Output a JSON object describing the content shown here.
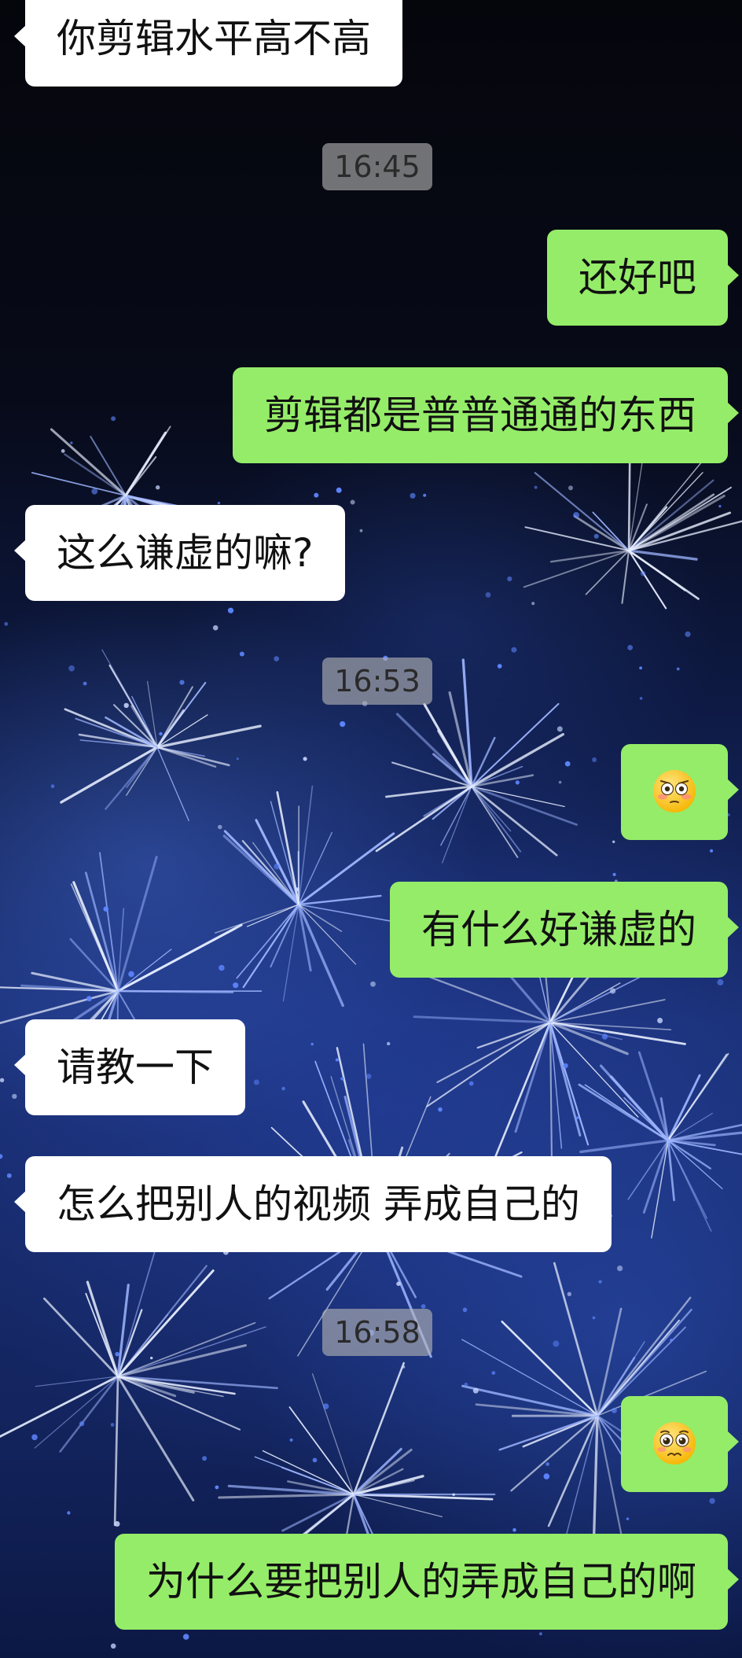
{
  "messages": [
    {
      "side": "incoming",
      "text": "你剪辑水平高不高"
    },
    {
      "time": "16:45"
    },
    {
      "side": "outgoing",
      "text": "还好吧"
    },
    {
      "side": "outgoing",
      "text": "剪辑都是普普通通的东西"
    },
    {
      "side": "incoming",
      "text": "这么谦虚的嘛?"
    },
    {
      "time": "16:53"
    },
    {
      "side": "outgoing",
      "emoji": "flushed-face-icon"
    },
    {
      "side": "outgoing",
      "text": "有什么好谦虚的"
    },
    {
      "side": "incoming",
      "text": "请教一下"
    },
    {
      "side": "incoming",
      "text": "怎么把别人的视频 弄成自己的"
    },
    {
      "time": "16:58"
    },
    {
      "side": "outgoing",
      "emoji": "pleading-face-icon"
    },
    {
      "side": "outgoing",
      "text": "为什么要把别人的弄成自己的啊"
    }
  ],
  "colors": {
    "incoming_bubble": "#ffffff",
    "outgoing_bubble": "#95ec69",
    "timestamp_bg": "#b4b4b4",
    "background": "#0e1a44"
  }
}
